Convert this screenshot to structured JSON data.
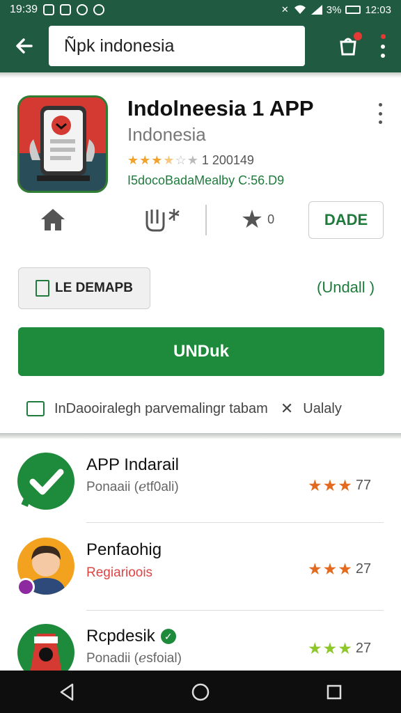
{
  "statusbar": {
    "time": "19:39",
    "battery": "3%",
    "clock_right": "12:03"
  },
  "search": {
    "query": "Ñpk indonesia"
  },
  "app": {
    "title": "Indolneesia 1 APP",
    "developer": "Indonesia",
    "rating_count": "1 200149",
    "rating_stars": 3.5,
    "meta": "I5docoBadaMealby C:56.D9"
  },
  "actions": {
    "star_count": "0",
    "outline_button": "DADE"
  },
  "secondary": {
    "demapb_label": "LE DEMAPB",
    "undall_label": "(Undall )"
  },
  "install_button": "UNDuk",
  "permission": {
    "text": "InDaooiralegh parvemalingr tabam",
    "suffix": "Ualaly"
  },
  "related": [
    {
      "name": "APP Indarail",
      "subtitle": "Ponaaii (ℯtf0ali)",
      "rating": "77",
      "star_color": "#e36a1e"
    },
    {
      "name": "Penfaohig",
      "subtitle": "Regiarioois",
      "rating": "27",
      "star_color": "#e36a1e"
    },
    {
      "name": "Rcpdesik",
      "subtitle": "Ponadii (ℯsfoial)",
      "rating": "27",
      "star_color": "#8ec62b"
    }
  ],
  "colors": {
    "brand": "#1f5a41",
    "accent": "#1e8a3c",
    "star": "#f0a22b"
  },
  "icons": {
    "back": "arrow-left-icon",
    "cart": "bag-notification-icon",
    "overflow": "more-vert-icon",
    "home": "home-icon",
    "nav_back": "triangle-back-icon",
    "nav_home": "circle-home-icon",
    "nav_recent": "square-recent-icon"
  }
}
